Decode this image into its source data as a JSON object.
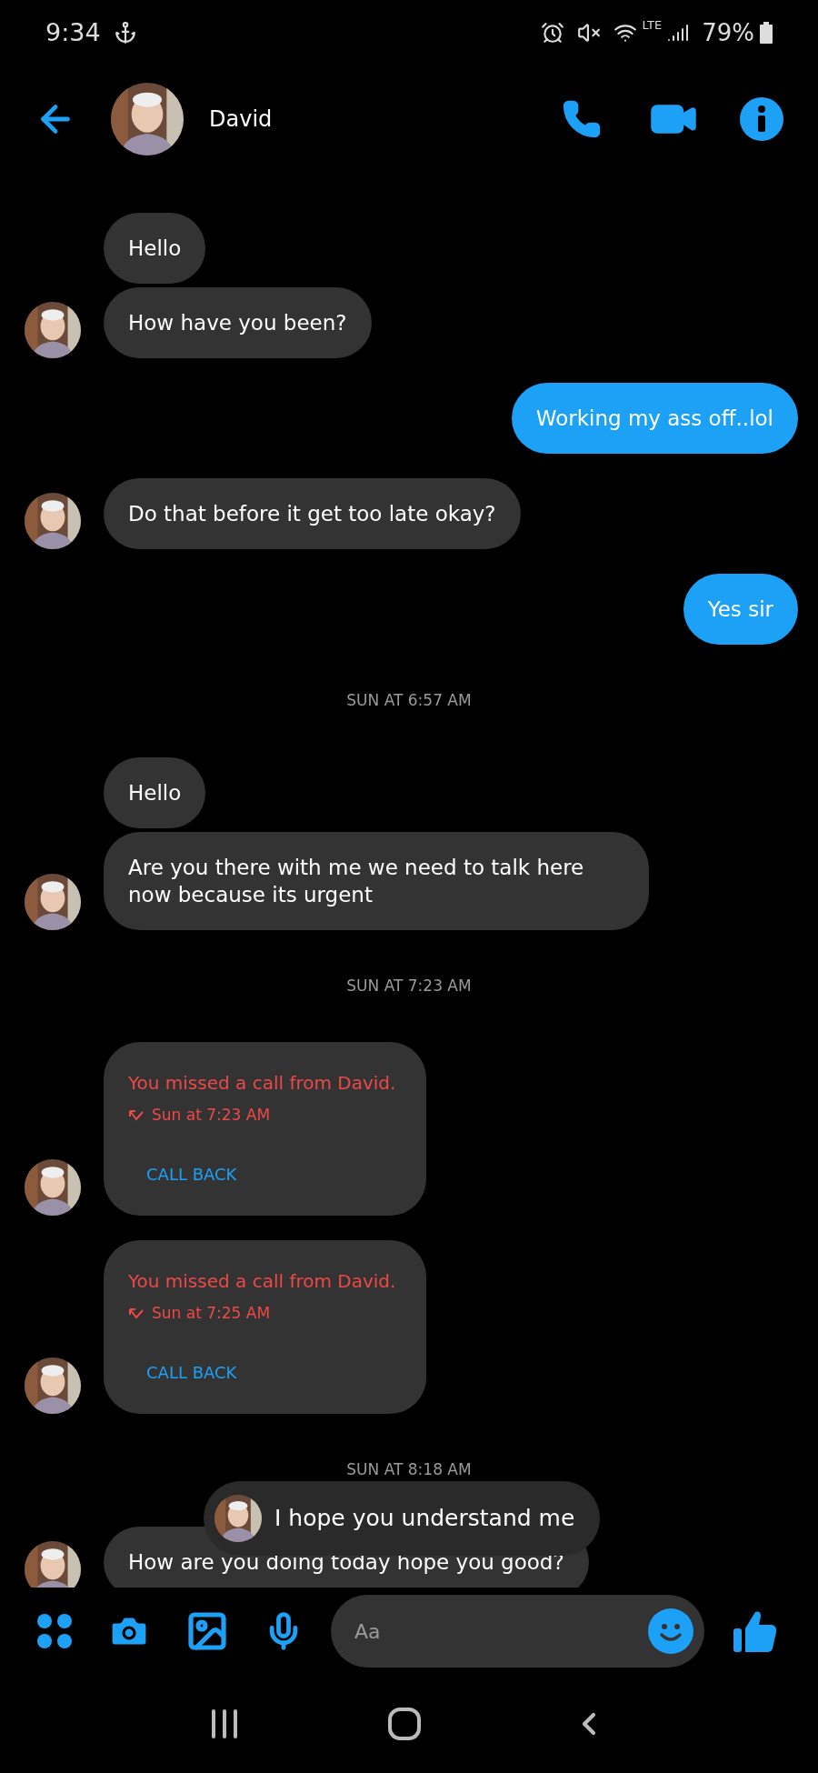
{
  "status_bar": {
    "time": "9:34",
    "network": "LTE",
    "battery": "79%"
  },
  "header": {
    "name": "David"
  },
  "thread": [
    {
      "kind": "incoming",
      "messages": [
        "Hello",
        "How have you been?"
      ]
    },
    {
      "kind": "outgoing",
      "messages": [
        "Working my ass off..lol"
      ]
    },
    {
      "kind": "incoming",
      "messages": [
        "Do that before it get too late okay?"
      ]
    },
    {
      "kind": "outgoing",
      "messages": [
        "Yes sir"
      ]
    },
    {
      "kind": "timestamp",
      "text": "SUN AT 6:57 AM"
    },
    {
      "kind": "incoming",
      "messages": [
        "Hello",
        "Are you there with me we need to talk here now because its urgent"
      ]
    },
    {
      "kind": "timestamp",
      "text": "SUN AT 7:23 AM"
    },
    {
      "kind": "missed_call",
      "title": "You missed a call from David.",
      "time": "Sun at 7:23 AM",
      "action": "CALL BACK"
    },
    {
      "kind": "missed_call",
      "title": "You missed a call from David.",
      "time": "Sun at 7:25 AM",
      "action": "CALL BACK"
    },
    {
      "kind": "timestamp",
      "text": "SUN AT 8:18 AM"
    },
    {
      "kind": "incoming",
      "messages": [
        "How are you doing today hope you good?"
      ]
    }
  ],
  "popup": {
    "text": "I hope you understand me"
  },
  "composer": {
    "placeholder": "Aa"
  }
}
